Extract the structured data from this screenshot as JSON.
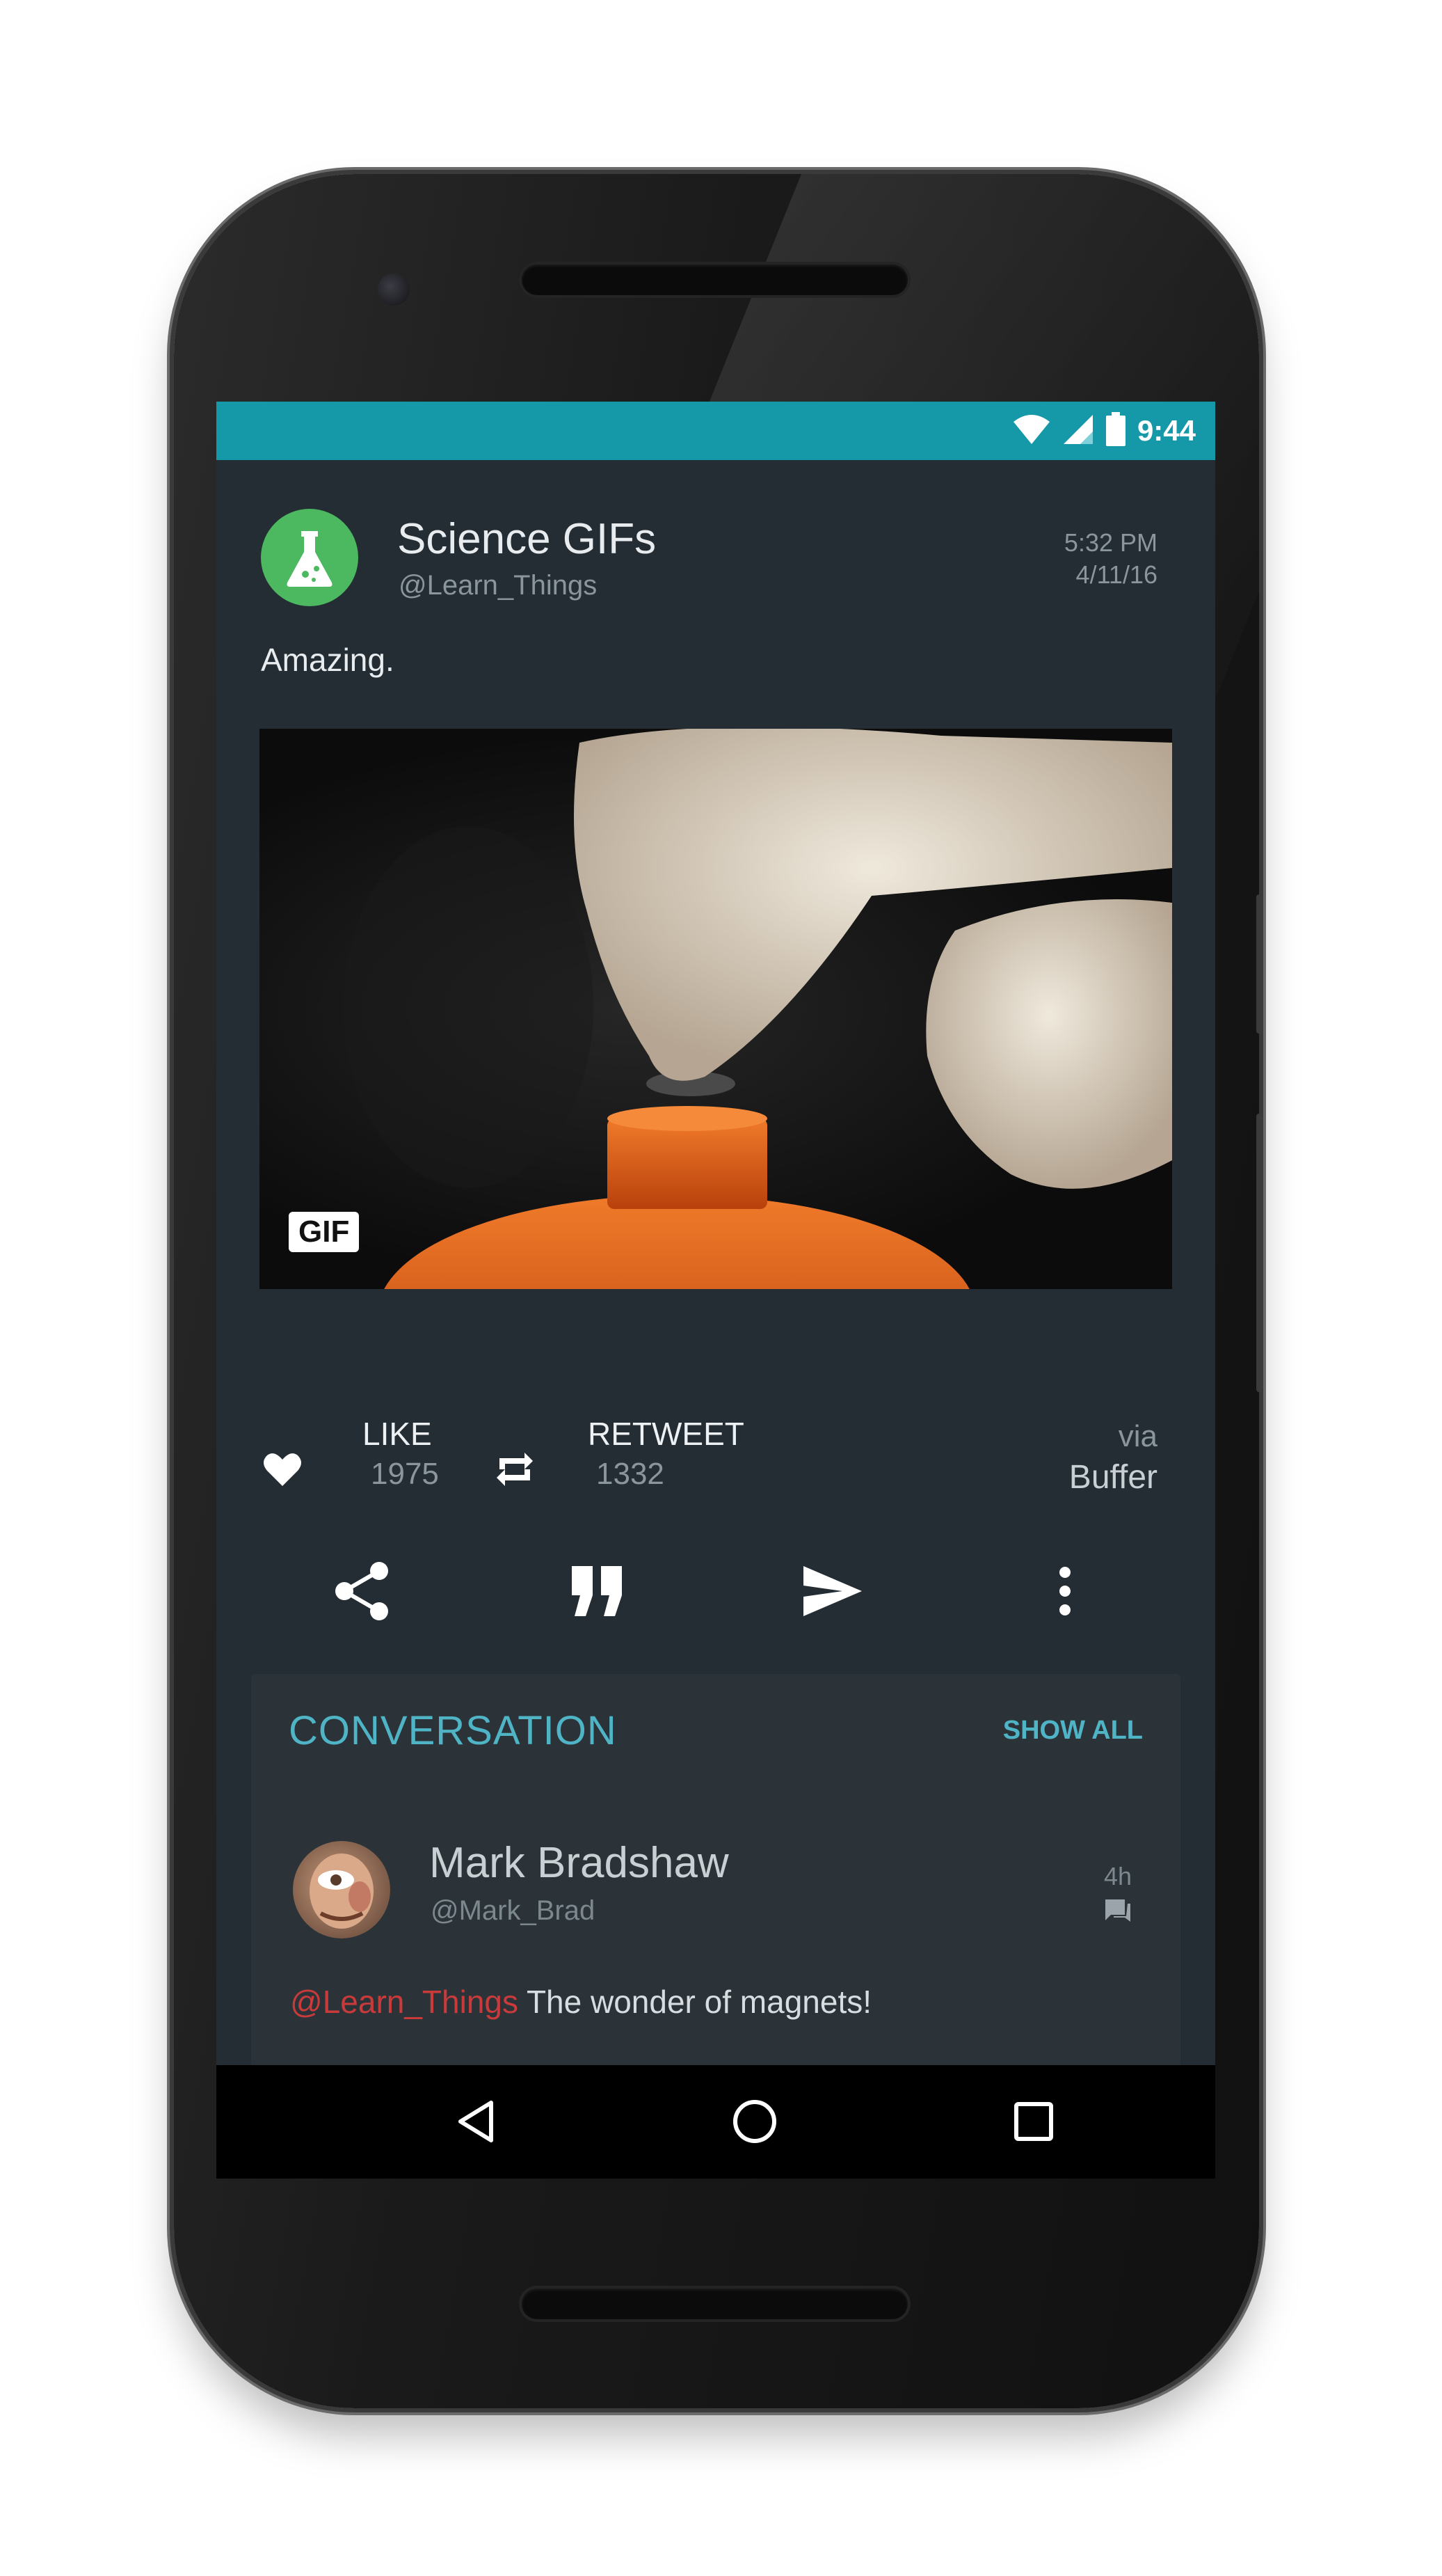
{
  "status_bar": {
    "time": "9:44",
    "icons": [
      "wifi-icon",
      "signal-icon",
      "battery-icon"
    ]
  },
  "tweet": {
    "author_name": "Science GIFs",
    "author_handle": "@Learn_Things",
    "time": "5:32 PM",
    "date": "4/11/16",
    "text": "Amazing.",
    "media_badge": "GIF",
    "like_label": "LIKE",
    "like_count": "1975",
    "retweet_label": "RETWEET",
    "retweet_count": "1332",
    "via_label": "via",
    "via_source": "Buffer"
  },
  "actions": [
    "share-icon",
    "quote-icon",
    "send-icon",
    "more-vert-icon"
  ],
  "conversation": {
    "title": "CONVERSATION",
    "show_all": "SHOW ALL",
    "reply": {
      "name": "Mark Bradshaw",
      "handle": "@Mark_Brad",
      "time": "4h",
      "mention": "@Learn_Things",
      "text": " The wonder of magnets!"
    }
  },
  "navigation": [
    "back-icon",
    "home-icon",
    "recents-icon"
  ],
  "colors": {
    "status_bar": "#1598a8",
    "background": "#242d34",
    "accent": "#4fb4c6",
    "mention": "#c93a3a",
    "avatar": "#4cb860"
  }
}
